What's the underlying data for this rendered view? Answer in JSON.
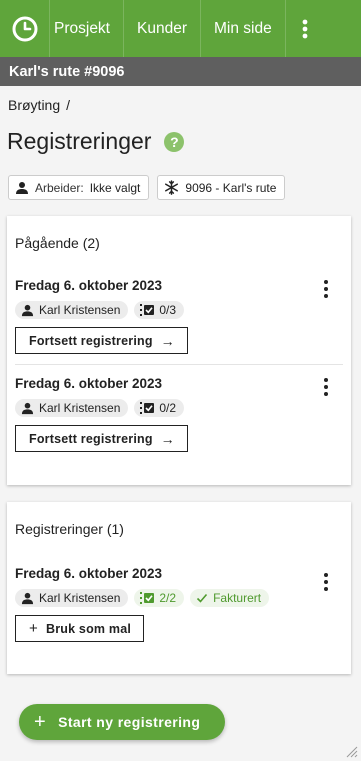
{
  "nav": {
    "items": [
      {
        "label": "Prosjekt"
      },
      {
        "label": "Kunder"
      },
      {
        "label": "Min side"
      }
    ],
    "logo_icon": "clock-icon",
    "menu_icon": "more-vertical-icon"
  },
  "route_title": "Karl's rute #9096",
  "breadcrumb": {
    "item": "Brøyting",
    "separator": "/"
  },
  "page": {
    "title": "Registreringer",
    "help": "?"
  },
  "filters": {
    "worker": {
      "label": "Arbeider:",
      "value": "Ikke valgt"
    },
    "route": {
      "value": "9096 - Karl's rute"
    }
  },
  "ongoing": {
    "header": "Pågående (2)",
    "entries": [
      {
        "date": "Fredag 6. oktober 2023",
        "person": "Karl Kristensen",
        "progress": "0/3",
        "action": "Fortsett registrering"
      },
      {
        "date": "Fredag 6. oktober 2023",
        "person": "Karl Kristensen",
        "progress": "0/2",
        "action": "Fortsett registrering"
      }
    ]
  },
  "registrations": {
    "header": "Registreringer (1)",
    "entries": [
      {
        "date": "Fredag 6. oktober 2023",
        "person": "Karl Kristensen",
        "progress": "2/2",
        "status": "Fakturert",
        "action": "Bruk som mal"
      }
    ]
  },
  "fab": {
    "label": "Start ny registrering"
  },
  "colors": {
    "brand_green": "#5fa53b",
    "subbar_grey": "#5f5f5f",
    "help_green": "#8cc26b"
  }
}
